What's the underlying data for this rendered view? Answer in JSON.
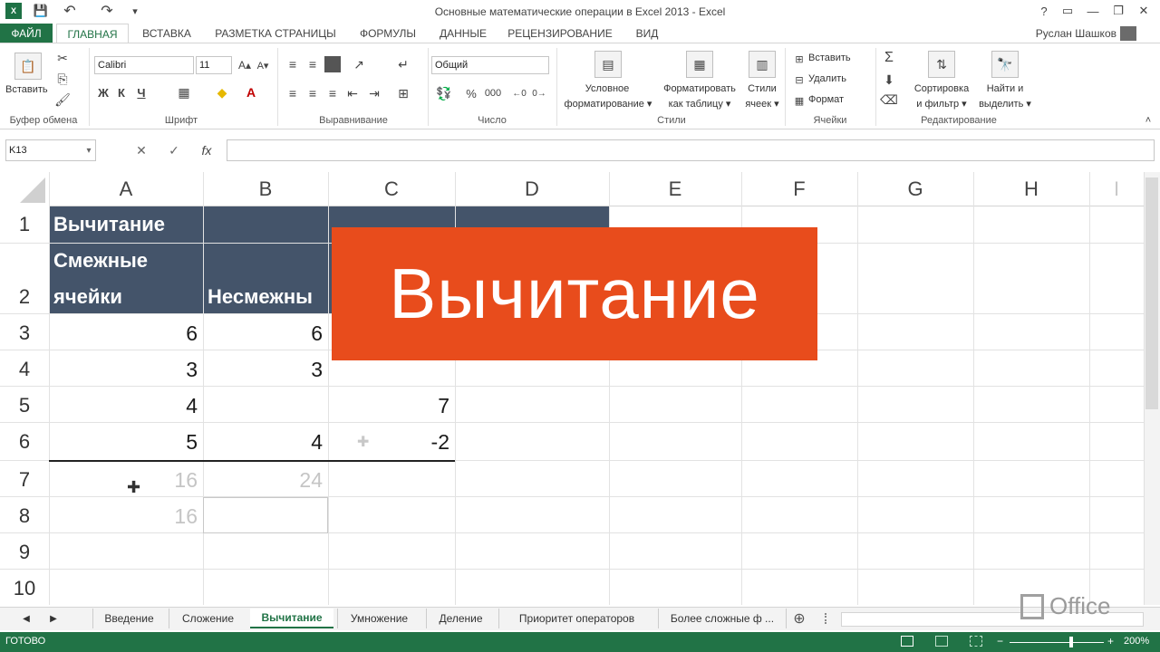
{
  "window": {
    "title": "Основные математические операции в Excel 2013 - Excel",
    "controls": [
      "?",
      "▭",
      "—",
      "❐",
      "✕"
    ]
  },
  "qat": {
    "app_icon": "X",
    "save": "💾",
    "undo": "↶",
    "redo": "↷",
    "customize": "▾"
  },
  "tabs": {
    "file": "ФАЙЛ",
    "items": [
      "ГЛАВНАЯ",
      "ВСТАВКА",
      "РАЗМЕТКА СТРАНИЦЫ",
      "ФОРМУЛЫ",
      "ДАННЫЕ",
      "РЕЦЕНЗИРОВАНИЕ",
      "ВИД"
    ],
    "active": "ГЛАВНАЯ",
    "user": "Руслан Шашков"
  },
  "ribbon": {
    "clipboard": {
      "paste": "Вставить",
      "label": "Буфер обмена"
    },
    "font": {
      "name": "Calibri",
      "size": "11",
      "bold": "Ж",
      "italic": "К",
      "underline": "Ч",
      "label": "Шрифт"
    },
    "alignment": {
      "label": "Выравнивание"
    },
    "number": {
      "format": "Общий",
      "percent": "%",
      "thousands": "000",
      "label": "Число"
    },
    "styles": {
      "conditional_1": "Условное",
      "conditional_2": "форматирование ▾",
      "table_1": "Форматировать",
      "table_2": "как таблицу ▾",
      "cell_1": "Стили",
      "cell_2": "ячеек ▾",
      "label": "Стили"
    },
    "cells": {
      "insert": "Вставить",
      "delete": "Удалить",
      "format": "Формат",
      "label": "Ячейки"
    },
    "editing": {
      "sort_1": "Сортировка",
      "sort_2": "и фильтр ▾",
      "find_1": "Найти и",
      "find_2": "выделить ▾",
      "label": "Редактирование"
    }
  },
  "formula_bar": {
    "name_box": "K13",
    "cancel": "✕",
    "enter": "✓",
    "fx": "fx",
    "content": ""
  },
  "columns": [
    "A",
    "B",
    "C",
    "D",
    "E",
    "F",
    "G",
    "H",
    "I"
  ],
  "rows": [
    "1",
    "2",
    "3",
    "4",
    "5",
    "6",
    "7",
    "8",
    "9",
    "10"
  ],
  "cells": {
    "A1": "Вычитание",
    "A2_line1": "Смежные",
    "A2_line2": "ячейки",
    "B2": "Несмежны",
    "A3": "6",
    "B3": "6",
    "A4": "3",
    "B4": "3",
    "A5": "4",
    "C5": "7",
    "A6": "5",
    "B6": "4",
    "C6": "-2",
    "A7": "16",
    "B7": "24",
    "A8": "16"
  },
  "banner": {
    "text": "Вычитание",
    "color": "#e84c1c"
  },
  "sheet_tabs": [
    "Введение",
    "Сложение",
    "Вычитание",
    "Умножение",
    "Деление",
    "Приоритет операторов",
    "Более сложные ф ..."
  ],
  "active_sheet": "Вычитание",
  "status": {
    "mode": "ГОТОВО",
    "zoom": "200%"
  },
  "brand": {
    "office": "Office"
  },
  "colors": {
    "excel_green": "#217346",
    "header_fill": "#44546a",
    "banner": "#e84c1c"
  }
}
